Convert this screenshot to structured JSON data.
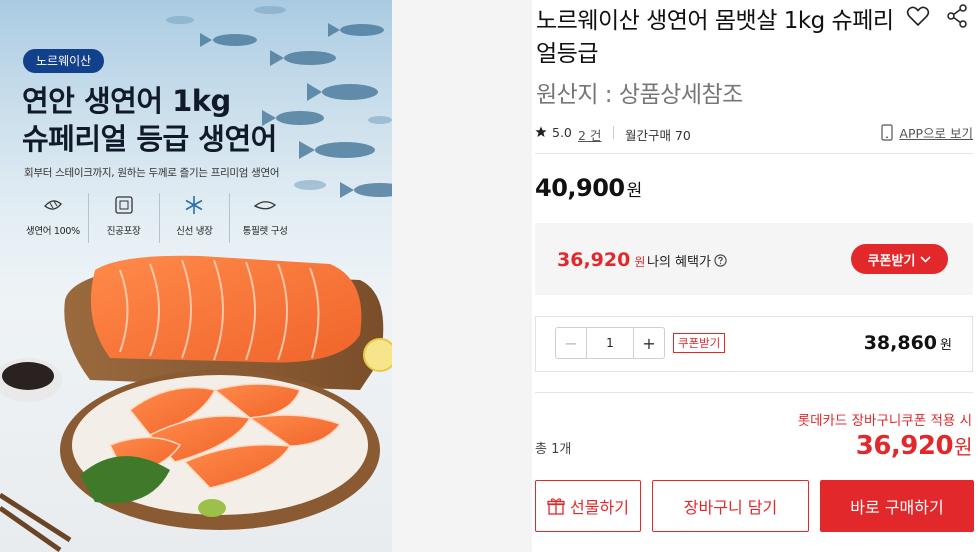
{
  "image": {
    "badge": "노르웨이산",
    "title_line1": "연안 생연어 1kg",
    "title_line2": "슈페리얼 등급 생연어",
    "subtitle": "회부터 스테이크까지, 원하는 두께로 즐기는 프리미엄 생연어",
    "features": [
      {
        "icon": "salmon-fillet-icon",
        "label": "생연어 100%"
      },
      {
        "icon": "vacuum-pack-icon",
        "label": "진공포장"
      },
      {
        "icon": "snowflake-icon",
        "label": "신선 냉장"
      },
      {
        "icon": "fillet-piece-icon",
        "label": "통필렛 구성"
      }
    ]
  },
  "product": {
    "title": "노르웨이산 생연어 몸뱃살 1kg 슈페리얼등급",
    "origin": "원산지 : 상품상세참조",
    "rating": "5.0",
    "review_count": "2 건",
    "monthly_purchase": "월간구매 70",
    "app_link": "APP으로 보기",
    "price": "40,900",
    "currency": "원"
  },
  "benefit": {
    "price": "36,920",
    "currency": "원",
    "label": "나의 혜택가",
    "coupon_button": "쿠폰받기"
  },
  "order": {
    "quantity": "1",
    "minus": "−",
    "plus": "+",
    "coupon_tag": "쿠폰받기",
    "line_price": "38,860",
    "currency": "원"
  },
  "summary": {
    "card_note": "롯데카드 장바구니쿠폰 적용 시",
    "total_label": "총 1개",
    "total_price": "36,920",
    "currency": "원"
  },
  "buttons": {
    "gift": "선물하기",
    "cart": "장바구니 담기",
    "buy": "바로 구매하기"
  },
  "colors": {
    "accent": "#e3282c",
    "badge": "#13408a",
    "box_bg": "#f5f5f5"
  }
}
